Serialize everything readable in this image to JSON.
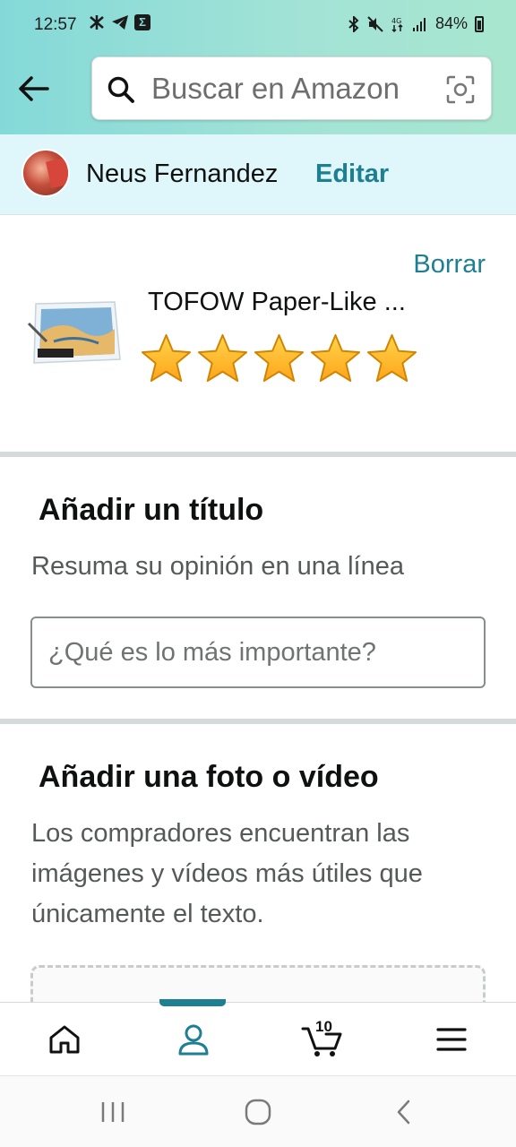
{
  "status_bar": {
    "time": "12:57",
    "battery": "84%"
  },
  "search": {
    "placeholder": "Buscar en Amazon"
  },
  "profile": {
    "name": "Neus Fernandez",
    "edit_label": "Editar"
  },
  "product": {
    "remove_label": "Borrar",
    "title": "TOFOW Paper-Like ...",
    "rating": 5,
    "max_rating": 5
  },
  "title_section": {
    "heading": "Añadir un título",
    "subtitle": "Resuma su opinión en una línea",
    "input_placeholder": "¿Qué es lo más importante?"
  },
  "media_section": {
    "heading": "Añadir una foto o vídeo",
    "description": "Los compradores encuentran las imágenes y vídeos más útiles que únicamente el texto."
  },
  "bottom_nav": {
    "items": [
      {
        "name": "home",
        "icon": "home-icon"
      },
      {
        "name": "account",
        "icon": "person-icon",
        "active": true
      },
      {
        "name": "cart",
        "icon": "cart-icon",
        "count": "10"
      },
      {
        "name": "menu",
        "icon": "menu-icon"
      }
    ]
  },
  "colors": {
    "accent": "#1d7f91",
    "star": "#ffa41c"
  }
}
